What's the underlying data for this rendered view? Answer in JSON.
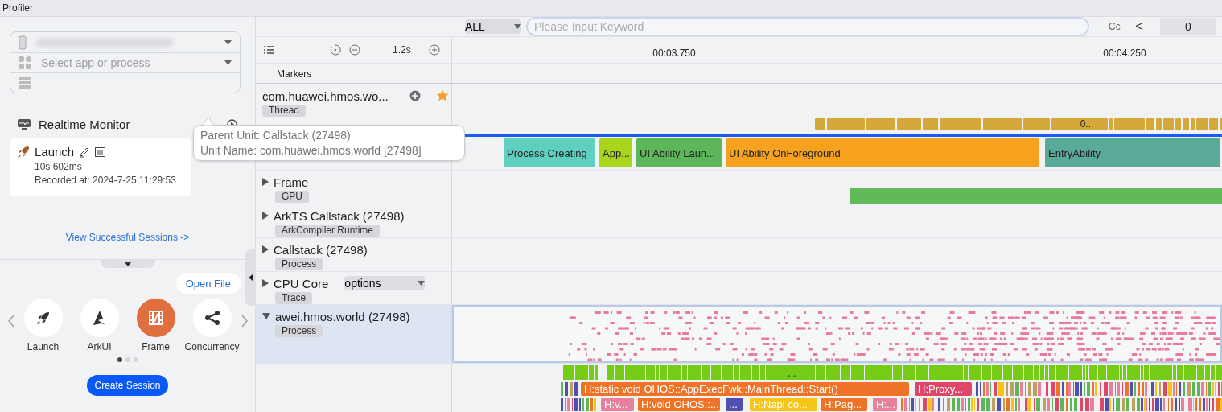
{
  "title": "Profiler",
  "sidebar": {
    "process_select": {
      "placeholder": "Select app or process"
    },
    "realtime_monitor": "Realtime Monitor",
    "session": {
      "name": "Launch",
      "duration": "10s 602ms",
      "recorded": "Recorded at: 2024-7-25 11:29:53"
    },
    "view_sessions": "View Successful Sessions ->",
    "open_file": "Open File",
    "templates": [
      {
        "label": "Launch",
        "kind": "launch",
        "selected": false
      },
      {
        "label": "ArkUI",
        "kind": "arkui",
        "selected": false
      },
      {
        "label": "Frame",
        "kind": "frame",
        "selected": true
      },
      {
        "label": "Concurrency",
        "kind": "concurrency",
        "selected": false
      }
    ],
    "pager": [
      {
        "selected": true
      },
      {
        "selected": false
      },
      {
        "selected": false
      }
    ],
    "create_session": "Create Session"
  },
  "toolbar": {
    "filter": "ALL",
    "search": {
      "placeholder": "Please Input Keyword"
    },
    "case_button": "Cc",
    "prev_button": "<",
    "match_count": "0"
  },
  "timeline": {
    "zoom_level": "1.2s",
    "ticks": [
      "00:03.750",
      "00:04.250"
    ],
    "markers_label": "Markers",
    "tracks": [
      {
        "kind": "thread",
        "name": "com.huawei.hmos.wo...",
        "tag": "Thread",
        "starred": true,
        "selected": false,
        "slices": [
          {
            "label": "0...",
            "color": "#d4a93a"
          }
        ]
      },
      {
        "kind": "covered",
        "selected": false,
        "slices": [
          {
            "label": "Process Creating",
            "color": "#5fcfbf"
          },
          {
            "label": "App...",
            "color": "#a9d51d"
          },
          {
            "label": "UI Ability Laun...",
            "color": "#5db65a"
          },
          {
            "label": "UI Ability OnForeground",
            "color": "#f6a21e"
          },
          {
            "label": "EntryAbility",
            "color": "#5aaa9a"
          }
        ]
      },
      {
        "kind": "track",
        "name": "Frame",
        "tag": "GPU",
        "expanded": false,
        "selected": false
      },
      {
        "kind": "track",
        "name": "ArkTS Callstack (27498)",
        "tag": "ArkCompiler Runtime",
        "expanded": false,
        "selected": false
      },
      {
        "kind": "track",
        "name": "Callstack (27498)",
        "tag": "Process",
        "expanded": false,
        "selected": false
      },
      {
        "kind": "track",
        "name": "CPU Core",
        "tag": "Trace",
        "options": "options",
        "expanded": false,
        "selected": false
      },
      {
        "kind": "process",
        "name": "awei.hmos.world (27498)",
        "tag": "Process",
        "expanded": true,
        "selected": true
      }
    ],
    "call_rows": [
      [
        {
          "label": "...",
          "color": "#74cc16"
        }
      ],
      [
        {
          "label": "H:static void OHOS::AppExecFwk::MainThread::Start()",
          "color": "#ee7326"
        },
        {
          "label": "H:Proxy...",
          "color": "#e0456a"
        }
      ],
      [
        {
          "label": "H:v...",
          "color": "#e8809b"
        },
        {
          "label": "H:void OHOS::...",
          "color": "#ee7326"
        },
        {
          "label": "...",
          "color": "#5050b0"
        },
        {
          "label": "H:Napi co...",
          "color": "#f5c518"
        },
        {
          "label": "H:Pag...",
          "color": "#ee7326"
        },
        {
          "label": "H:...",
          "color": "#e8809b"
        }
      ]
    ]
  },
  "tooltip": {
    "lines": [
      "Parent Unit:  Callstack (27498)",
      "Unit Name:  com.huawei.hmos.world [27498]"
    ]
  }
}
